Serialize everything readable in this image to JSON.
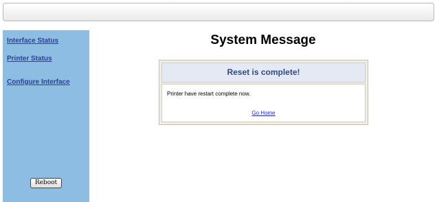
{
  "page": {
    "title": "System Message"
  },
  "sidebar": {
    "items": [
      {
        "label": "Interface Status"
      },
      {
        "label": "Printer Status"
      },
      {
        "label": "Configure Interface"
      }
    ],
    "reboot_label": "Reboot"
  },
  "message": {
    "heading": "Reset is complete!",
    "text": "Printer have restart complete now.",
    "link_label": "Go Home"
  }
}
